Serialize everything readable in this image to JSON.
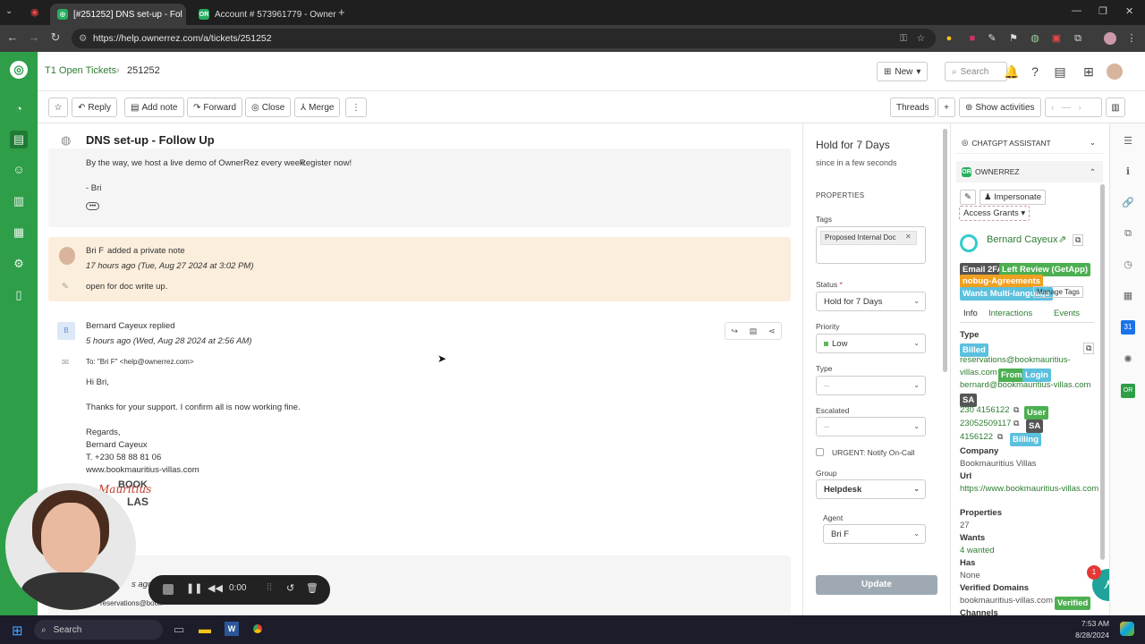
{
  "browser": {
    "tabs": [
      {
        "label": "[#251252] DNS set-up - Fol"
      },
      {
        "label": "Account # 573961779 - Owner"
      }
    ],
    "url": "https://help.ownerrez.com/a/tickets/251252"
  },
  "header": {
    "breadcrumb_queue": "T1 Open Tickets",
    "breadcrumb_id": "251252",
    "new_label": "New",
    "search_placeholder": "Search"
  },
  "toolbar": {
    "reply": "Reply",
    "add_note": "Add note",
    "forward": "Forward",
    "close": "Close",
    "merge": "Merge",
    "threads": "Threads",
    "show_activities": "Show activities"
  },
  "ticket": {
    "subject": "DNS set-up - Follow Up"
  },
  "messages": {
    "m1": {
      "text_prefix": "By the way, we host a live demo of OwnerRez every week.",
      "link": "Register now!",
      "sign": "- Bri"
    },
    "m2": {
      "author": "Bri F",
      "action": "added a private note",
      "time": "17 hours ago (Tue, Aug 27 2024 at 3:02 PM)",
      "body": "open for doc write up."
    },
    "m3": {
      "author": "Bernard Cayeux",
      "action": "replied",
      "time": "5 hours ago (Wed, Aug 28 2024 at 2:56 AM)",
      "to": "To: \"Bri F\" <help@ownerrez.com>",
      "l1": "Hi Bri,",
      "l2": "Thanks for your support. I confirm all is now working fine.",
      "l3": "Regards,",
      "l4": "Bernard Cayeux",
      "l5": "T. +230 58 88 81 06",
      "l6": "www.bookmauritius-villas.com",
      "logo_text1": "BOOK",
      "logo_text2": "Mauritius",
      "logo_text3": "LAS"
    },
    "m4": {
      "time": "s ago (",
      "email": "reservations@book"
    }
  },
  "recorder": {
    "time": "0:00"
  },
  "properties": {
    "status_title": "Hold for 7 Days",
    "status_sub": "since in a few seconds",
    "section": "PROPERTIES",
    "tags_label": "Tags",
    "tag": "Proposed Internal Doc",
    "status_label": "Status",
    "status_value": "Hold for 7 Days",
    "priority_label": "Priority",
    "priority_value": "Low",
    "type_label": "Type",
    "type_value": "--",
    "escalated_label": "Escalated",
    "escalated_value": "--",
    "urgent_label": "URGENT: Notify On-Call",
    "group_label": "Group",
    "group_value": "Helpdesk",
    "agent_label": "Agent",
    "agent_value": "Bri F",
    "update": "Update"
  },
  "rpanel": {
    "chatgpt": "CHATGPT ASSISTANT",
    "ownerrez": "OWNERREZ",
    "impersonate": "Impersonate",
    "access": "Access Grants",
    "name": "Bernard Cayeux",
    "badges": [
      "Email 2FA",
      "Left Review (GetApp)",
      "nobug-Agreements",
      "Wants Multi-language"
    ],
    "manage_tags": "Manage Tags",
    "tabs": [
      "Info",
      "Interactions",
      "Events"
    ],
    "type_h": "Type",
    "billed": "Billed",
    "email1a": "reservations@bookmauritius-",
    "email1b": "villas.com",
    "from": "From",
    "login": "Login",
    "email2": "bernard@bookmauritius-villas.com",
    "sa": "SA",
    "phone1": "230 4156122",
    "user": "User",
    "phone2": "23052509117",
    "phone3": "4156122",
    "billing": "Billing",
    "company_h": "Company",
    "company": "Bookmauritius Villas",
    "url_h": "Url",
    "url": "https://www.bookmauritius-villas.com",
    "props_h": "Properties",
    "props": "27",
    "wants_h": "Wants",
    "wants": "4 wanted",
    "has_h": "Has",
    "has": "None",
    "vd_h": "Verified Domains",
    "vd": "bookmauritius-villas.com",
    "verified": "Verified",
    "channels_h": "Channels",
    "notif": "1"
  },
  "taskbar": {
    "search": "Search",
    "time": "7:53 AM",
    "date": "8/28/2024"
  }
}
